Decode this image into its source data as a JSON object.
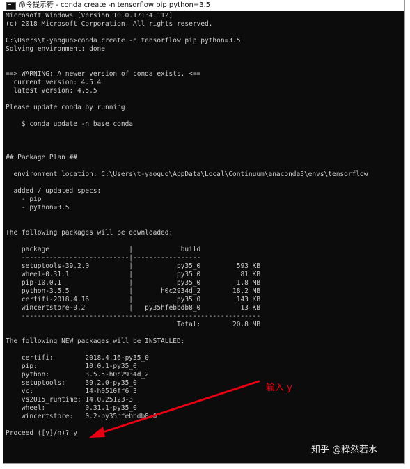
{
  "window": {
    "title": "命令提示符 - conda  create -n tensorflow pip python=3.5",
    "icon": "cmd-icon"
  },
  "console": {
    "lines": [
      "Microsoft Windows [Version 10.0.17134.112]",
      "(c) 2018 Microsoft Corporation. All rights reserved.",
      "",
      "C:\\Users\\t-yaoguo>conda create -n tensorflow pip python=3.5",
      "Solving environment: done",
      "",
      "",
      "==> WARNING: A newer version of conda exists. <==",
      "  current version: 4.5.4",
      "  latest version: 4.5.5",
      "",
      "Please update conda by running",
      "",
      "    $ conda update -n base conda",
      "",
      "",
      "",
      "## Package Plan ##",
      "",
      "  environment location: C:\\Users\\t-yaoguo\\AppData\\Local\\Continuum\\anaconda3\\envs\\tensorflow",
      "",
      "  added / updated specs:",
      "    - pip",
      "    - python=3.5",
      "",
      "",
      "The following packages will be downloaded:",
      "",
      "    package                    |            build",
      "    ---------------------------|-----------------",
      "    setuptools-39.2.0          |           py35_0         593 KB",
      "    wheel-0.31.1               |           py35_0          81 KB",
      "    pip-10.0.1                 |           py35_0         1.8 MB",
      "    python-3.5.5               |       h0c2934d_2        18.2 MB",
      "    certifi-2018.4.16          |           py35_0         143 KB",
      "    wincertstore-0.2           |   py35hfebbdb8_0          13 KB",
      "    ------------------------------------------------------------",
      "                                           Total:        20.8 MB",
      "",
      "The following NEW packages will be INSTALLED:",
      "",
      "    certifi:        2018.4.16-py35_0",
      "    pip:            10.0.1-py35_0",
      "    python:         3.5.5-h0c2934d_2",
      "    setuptools:     39.2.0-py35_0",
      "    vc:             14-h0510ff6_3",
      "    vs2015_runtime: 14.0.25123-3",
      "    wheel:          0.31.1-py35_0",
      "    wincertstore:   0.2-py35hfebbdb8_0",
      "",
      "Proceed ([y]/n)? y"
    ]
  },
  "annotation": {
    "text": "输入 y",
    "color": "#e60012"
  },
  "watermark": {
    "text": "知乎 @释然若水"
  }
}
